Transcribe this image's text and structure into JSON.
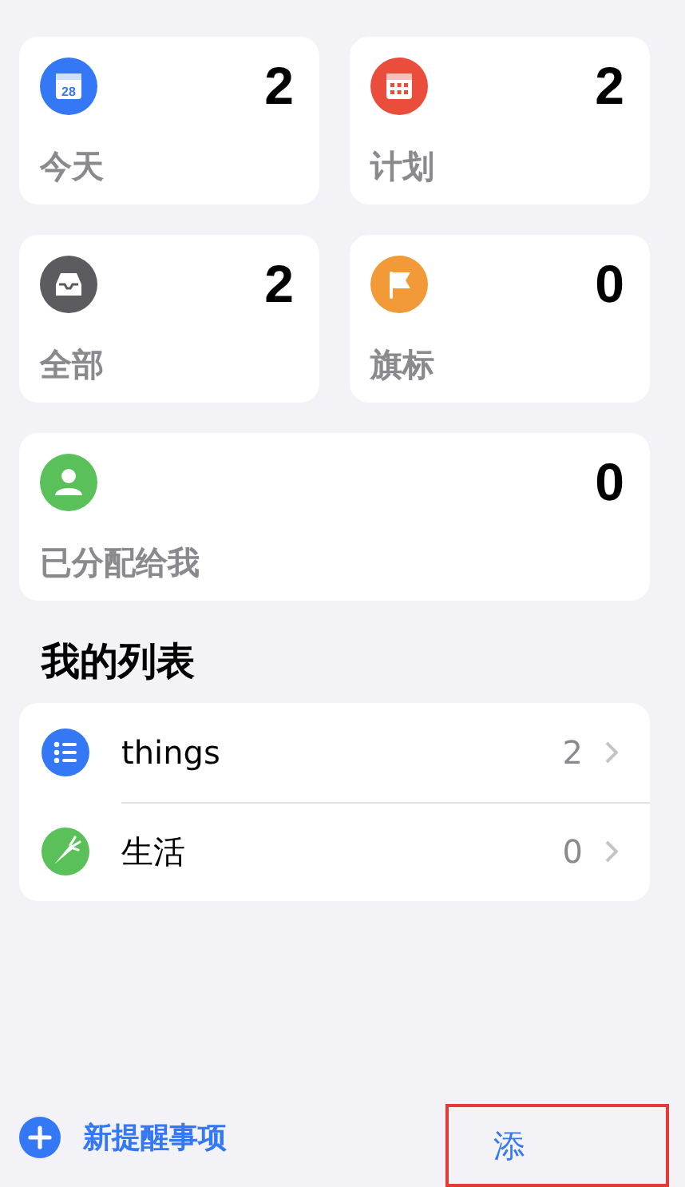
{
  "smart_lists": [
    {
      "kind": "today",
      "label": "今天",
      "count": "2",
      "color": "#3478f6",
      "icon_text": "28"
    },
    {
      "kind": "scheduled",
      "label": "计划",
      "count": "2",
      "color": "#eb4d3d"
    },
    {
      "kind": "all",
      "label": "全部",
      "count": "2",
      "color": "#5b5b60"
    },
    {
      "kind": "flagged",
      "label": "旗标",
      "count": "0",
      "color": "#f19a37"
    },
    {
      "kind": "assigned",
      "label": "已分配给我",
      "count": "0",
      "color": "#5ac05a"
    }
  ],
  "section_title": "我的列表",
  "lists": [
    {
      "kind": "list",
      "name": "things",
      "count": "2",
      "color": "#3478f6"
    },
    {
      "kind": "carrot",
      "name": "生活",
      "count": "0",
      "color": "#5ac05a"
    }
  ],
  "bottom_bar": {
    "new_reminder": "新提醒事项",
    "add_list": "添",
    "highlighted": true
  }
}
